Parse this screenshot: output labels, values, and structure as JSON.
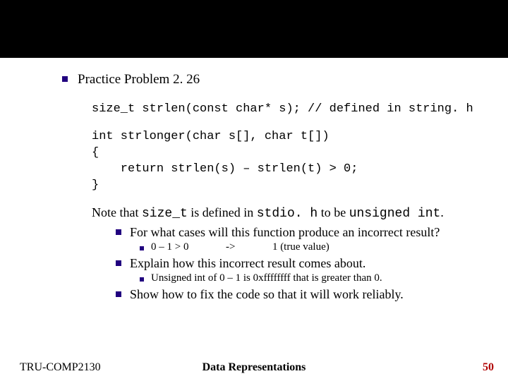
{
  "heading": "Practice Problem 2. 26",
  "code_line1": "size_t strlen(const char* s); // defined in string. h",
  "code_block": "int strlonger(char s[], char t[])\n{\n    return strlen(s) – strlen(t) > 0;\n}",
  "note_pre": "Note that ",
  "note_code1": "size_t",
  "note_mid1": " is defined in ",
  "note_code2": "stdio. h",
  "note_mid2": " to be ",
  "note_code3": "unsigned int",
  "note_post": ".",
  "q1": "For what cases will this function produce an incorrect result?",
  "q1_sub_a": "0 – 1 > 0",
  "q1_sub_arrow": "->",
  "q1_sub_b": "1 (true value)",
  "q2": "Explain how this incorrect result comes about.",
  "q2_sub": "Unsigned int of  0 – 1 is 0xffffffff that is greater than 0.",
  "q3": "Show how to fix the code so that it will work reliably.",
  "footer_left": "TRU-COMP2130",
  "footer_center": "Data Representations",
  "footer_right": "50"
}
